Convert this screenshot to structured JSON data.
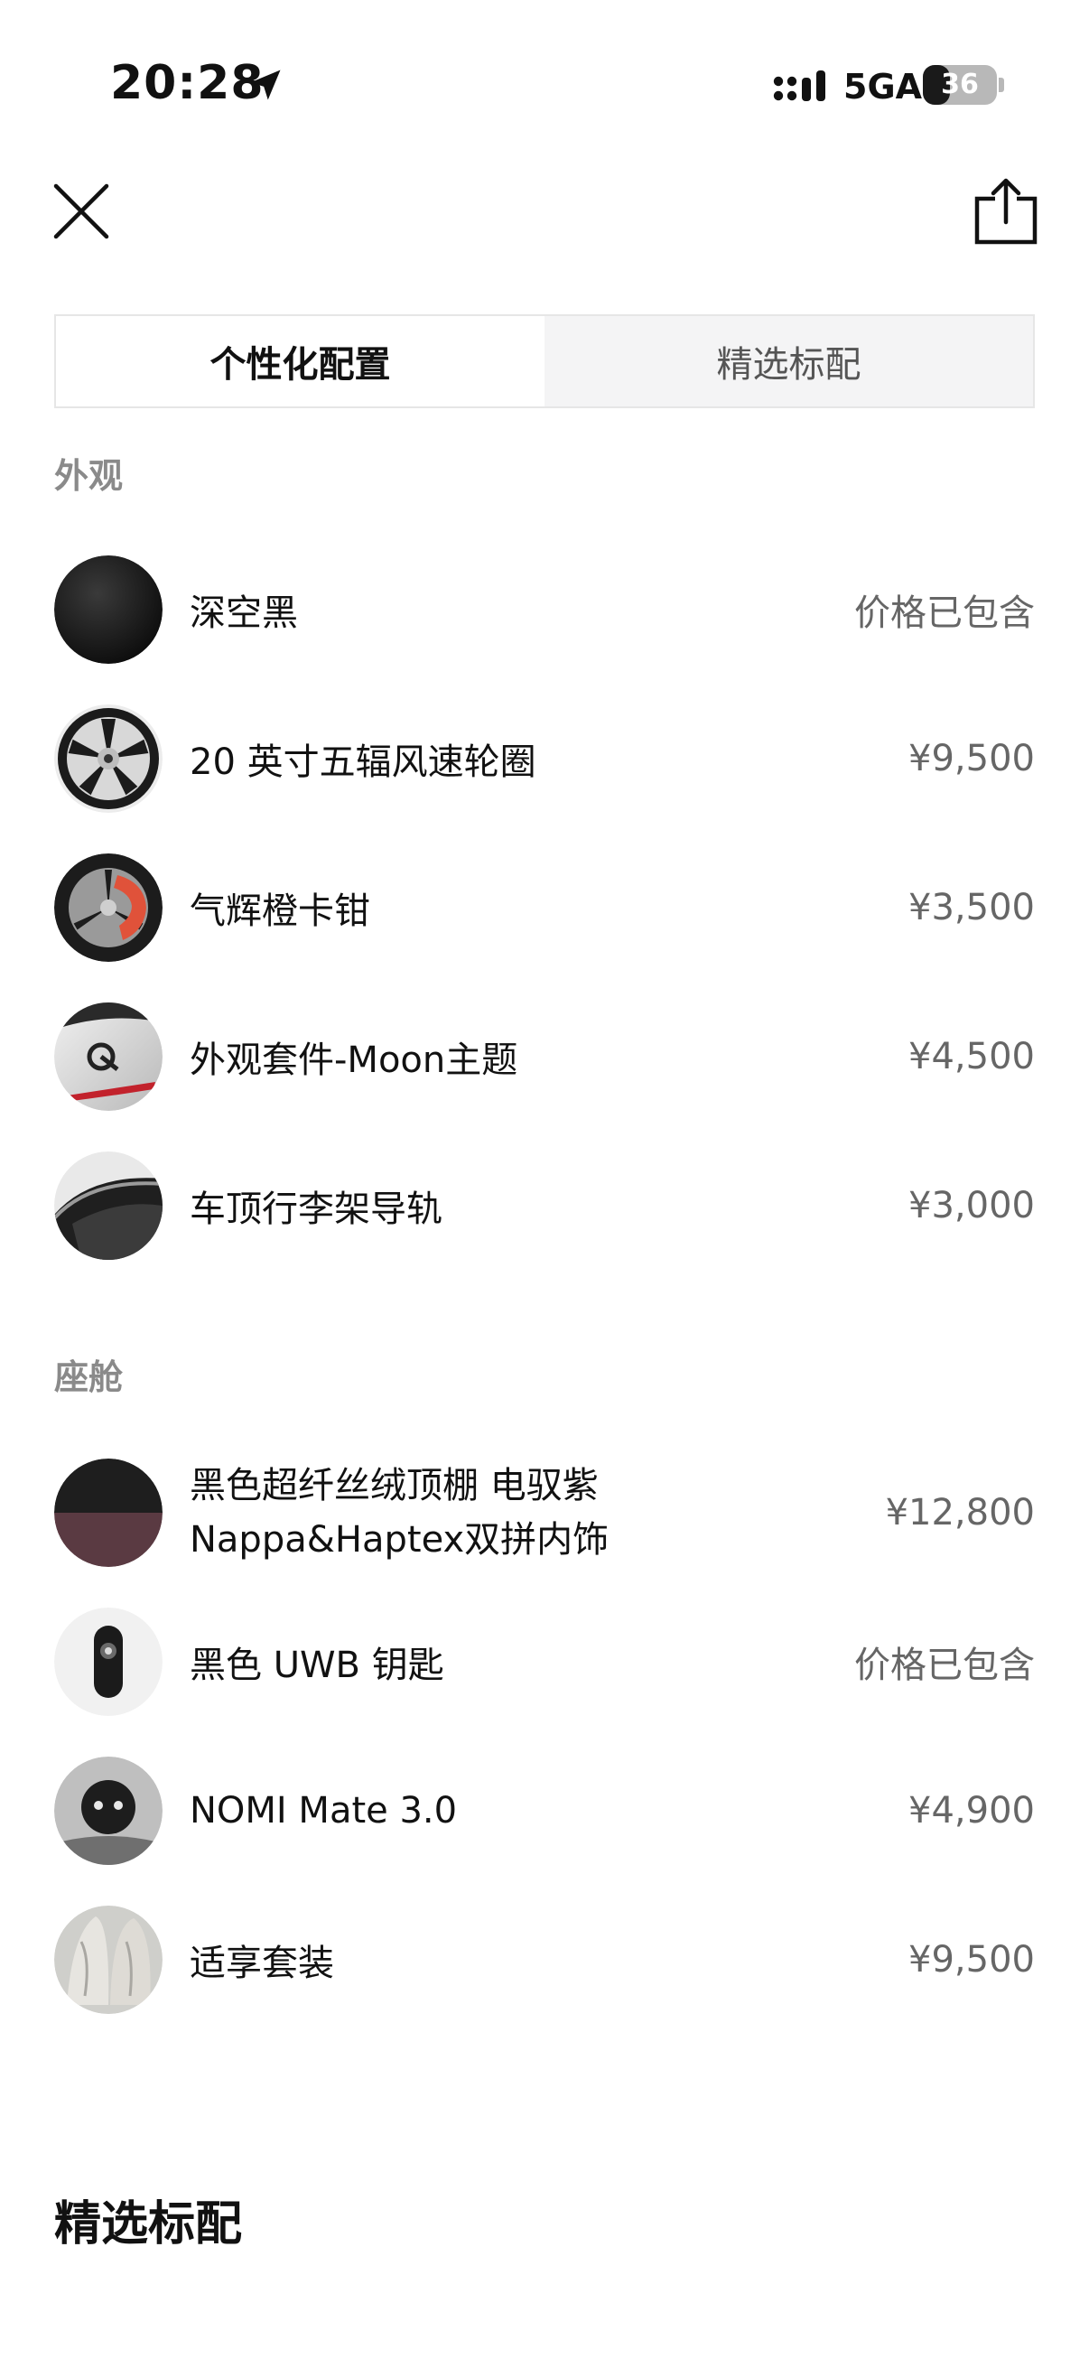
{
  "status_bar": {
    "time": "20:28",
    "network": "5GA",
    "battery": "36",
    "battery_level": 0.36,
    "icons": [
      "location-arrow-icon",
      "signal-bars-icon",
      "battery-icon"
    ]
  },
  "nav": {
    "close_icon": "close-icon",
    "share_icon": "share-icon"
  },
  "tabs": [
    {
      "label": "个性化配置",
      "active": true
    },
    {
      "label": "精选标配",
      "active": false
    }
  ],
  "sections": {
    "exterior": {
      "title": "外观",
      "items": [
        {
          "name": "深空黑",
          "price": "价格已包含",
          "thumb": "black-paint-swatch"
        },
        {
          "name": "20 英寸五辐风速轮圈",
          "price": "¥9,500",
          "thumb": "wheel-image"
        },
        {
          "name": "气辉橙卡钳",
          "price": "¥3,500",
          "thumb": "orange-caliper-image"
        },
        {
          "name": "外观套件-Moon主题",
          "price": "¥4,500",
          "thumb": "moon-theme-badge-image"
        },
        {
          "name": "车顶行李架导轨",
          "price": "¥3,000",
          "thumb": "roof-rail-image"
        }
      ]
    },
    "cabin": {
      "title": "座舱",
      "items": [
        {
          "name_line1": "黑色超纤丝绒顶棚 电驭紫",
          "name_line2": "Nappa&Haptex双拼内饰",
          "price": "¥12,800",
          "thumb": "interior-swatch"
        },
        {
          "name": "黑色 UWB 钥匙",
          "price": "价格已包含",
          "thumb": "uwb-key-image"
        },
        {
          "name": "NOMI Mate 3.0",
          "price": "¥4,900",
          "thumb": "nomi-mate-image"
        },
        {
          "name": "适享套装",
          "price": "¥9,500",
          "thumb": "comfort-seat-image"
        }
      ]
    }
  },
  "bottom_heading": "精选标配",
  "colors": {
    "text_primary": "#111111",
    "text_secondary": "#666666",
    "section_title": "#8a8a8a",
    "tab_inactive_bg": "#f4f4f5",
    "accent_orange": "#e0523a",
    "accent_purple": "#5a3a42"
  }
}
